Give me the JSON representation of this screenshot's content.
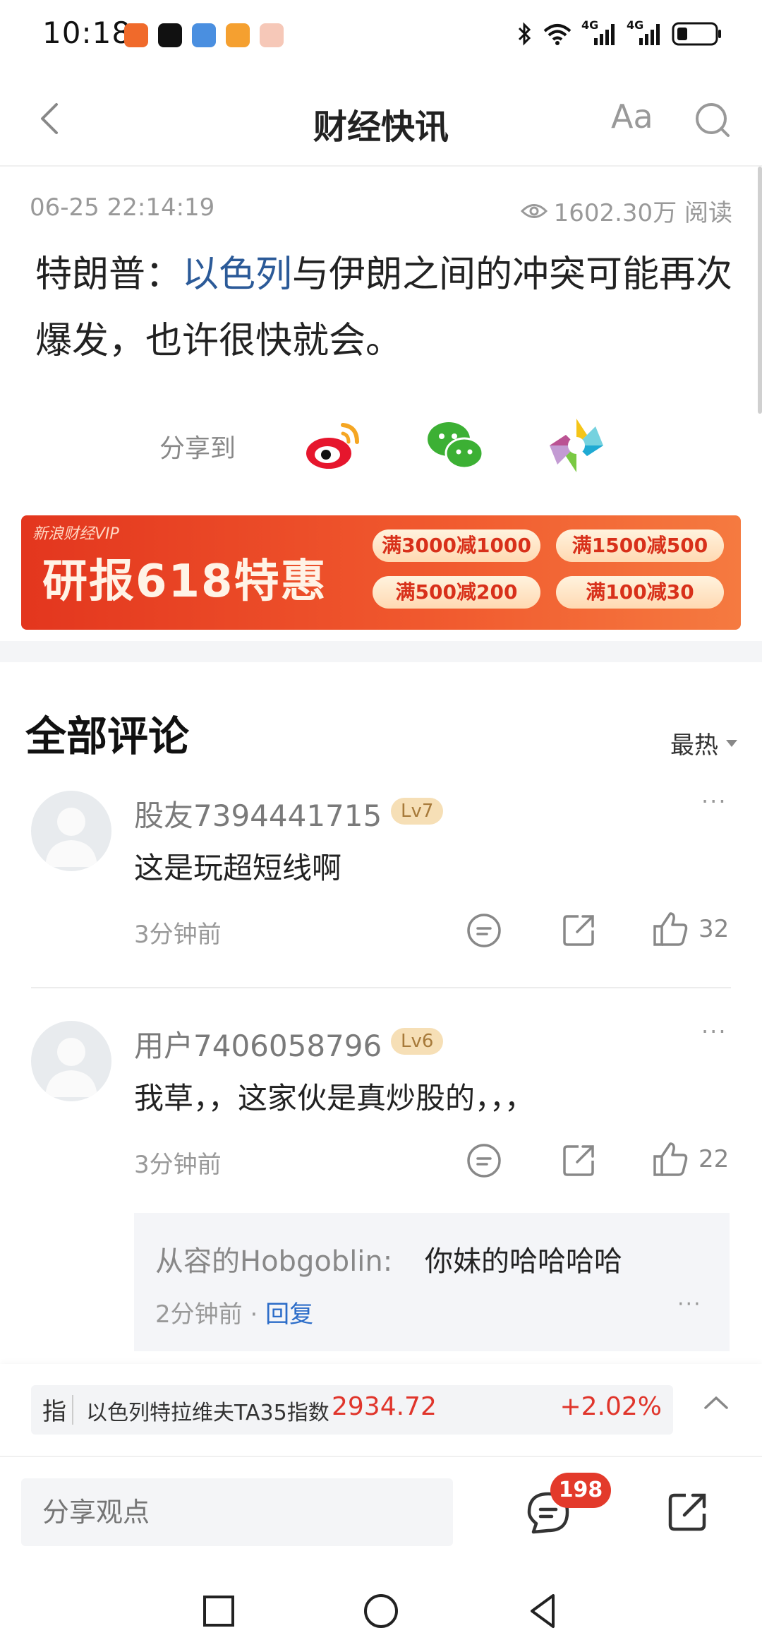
{
  "status_bar": {
    "time": "10:18",
    "net1": "4G",
    "net2": "4G"
  },
  "header": {
    "title": "财经快讯",
    "font_button": "Aa"
  },
  "article": {
    "timestamp": "06-25 22:14:19",
    "views": "1602.30万 阅读",
    "headline_prefix": "特朗普：",
    "headline_link": "以色列",
    "headline_suffix": "与伊朗之间的冲突可能再次爆发，也许很快就会。",
    "share_label": "分享到"
  },
  "banner": {
    "small_text": "新浪财经VIP",
    "main_text": "研报618特惠",
    "coupons": [
      "满3000减1000",
      "满1500减500",
      "满500减200",
      "满100减30"
    ]
  },
  "comments_section": {
    "title": "全部评论",
    "sort_label": "最热",
    "comments": [
      {
        "username": "股友7394441715",
        "level": "Lv7",
        "text": "这是玩超短线啊",
        "time": "3分钟前",
        "likes": "32",
        "more": "···"
      },
      {
        "username": "用户7406058796",
        "level": "Lv6",
        "text": "我草，，这家伙是真炒股的，，，",
        "time": "3分钟前",
        "likes": "22",
        "more": "···"
      }
    ],
    "reply": {
      "user": "从容的Hobgoblin:",
      "text": "你妹的哈哈哈哈",
      "time": "2分钟前",
      "dot": "·",
      "reply_label": "回复",
      "more": "···"
    }
  },
  "index_strip": {
    "tag": "指",
    "name": "以色列特拉维夫TA35指数",
    "value": "2934.72",
    "change": "+2.02%",
    "change_color": "#e0352b"
  },
  "bottom_bar": {
    "input_placeholder": "分享观点",
    "comment_count": "198"
  },
  "colors": {
    "accent_blue": "#2b5a98",
    "badge_red": "#e33a2b"
  }
}
